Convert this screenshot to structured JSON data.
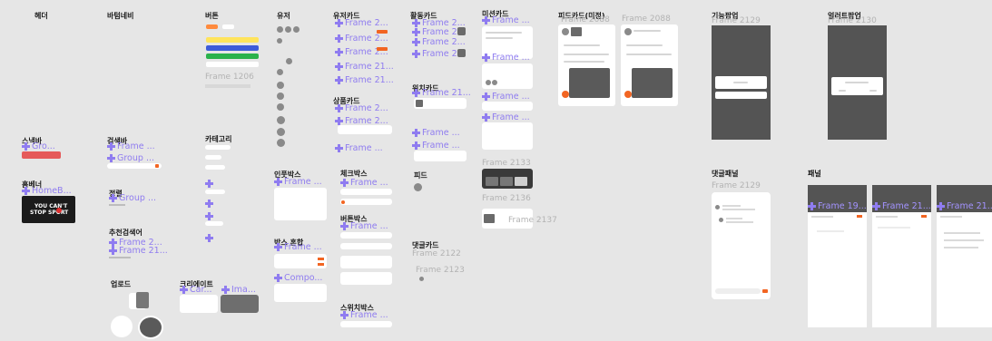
{
  "sections": {
    "header": "헤더",
    "bottom_nav": "바텀네비",
    "button": "버튼",
    "user": "유저",
    "user_card": "유저카드",
    "activity_card": "활동카드",
    "mission_card": "미션카드",
    "feed_card": "피드카드(미정)",
    "function_popup": "기능팝업",
    "alert_popup": "얼러트팝업",
    "snackbar": "스낵바",
    "home_banner": "홈베너",
    "search_bar": "검색바",
    "sort": "정렬",
    "recommend_search": "추천검색어",
    "upload": "업로드",
    "create": "크리에이트",
    "category": "카테고리",
    "input_box": "인풋박스",
    "box_combined": "박스 혼합",
    "product_card": "상품카드",
    "checkbox": "체크박스",
    "button_box": "버튼박스",
    "switch_box": "스위치박스",
    "watch_card": "위치카드",
    "feed": "피드",
    "comment_card": "댓글카드",
    "comment_panel": "댓글패널",
    "panel": "패널"
  },
  "frames": {
    "f1206": "Frame 1206",
    "f2088": "Frame 2088",
    "f2129": "Frame 2129",
    "f2130": "Frame 2130",
    "f2133": "Frame 2133",
    "f2136": "Frame 2136",
    "f2137": "Frame 2137",
    "f2122": "Frame 2122",
    "f2123": "Frame 2123",
    "f2129b": "Frame 2129"
  },
  "instances": {
    "frame_short": "Frame ...",
    "frame_2": "Frame 2...",
    "frame_21": "Frame 21...",
    "frame_2_dots": "Frame 2...",
    "gro": "Gro...",
    "group": "Group ...",
    "homeb": "HomeB...",
    "frame_2_rec": "Frame 2...",
    "frame_21_rec": "Frame 21...",
    "compo": "Compo...",
    "car": "Car...",
    "ima": "Ima...",
    "frame_19": "Frame 19...",
    "frame_21_panel": "Frame 21..."
  },
  "banner": {
    "line1": "YOU CAN'T",
    "line2": "STOP SPORT"
  },
  "colors": {
    "canvas": "#e6e6e6",
    "instance": "#8f7cf0",
    "frame_label": "#b3b3b3",
    "accent_orange": "#f26522",
    "popup_dark": "#545454",
    "snackbar_red": "#e55a5a",
    "btn_yellow": "#ffe45c",
    "btn_blue": "#3d5bd9",
    "btn_green": "#2bb24c",
    "btn_orange": "#ff8a3d"
  },
  "icons": {
    "component": "component-instance-icon"
  }
}
